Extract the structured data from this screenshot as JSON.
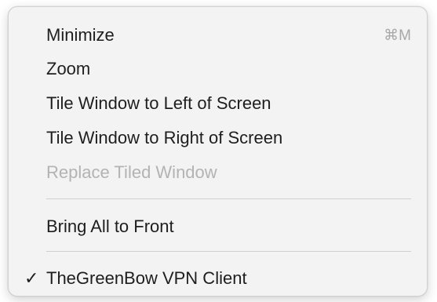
{
  "menu": {
    "items": [
      {
        "label": "Minimize",
        "shortcut": "⌘M",
        "enabled": true,
        "checked": false
      },
      {
        "label": "Zoom",
        "enabled": true,
        "checked": false
      },
      {
        "label": "Tile Window to Left of Screen",
        "enabled": true,
        "checked": false
      },
      {
        "label": "Tile Window to Right of Screen",
        "enabled": true,
        "checked": false
      },
      {
        "label": "Replace Tiled Window",
        "enabled": false,
        "checked": false
      },
      {
        "label": "Bring All to Front",
        "enabled": true,
        "checked": false
      },
      {
        "label": "TheGreenBow VPN Client",
        "enabled": true,
        "checked": true,
        "check_mark": "✓"
      }
    ]
  }
}
